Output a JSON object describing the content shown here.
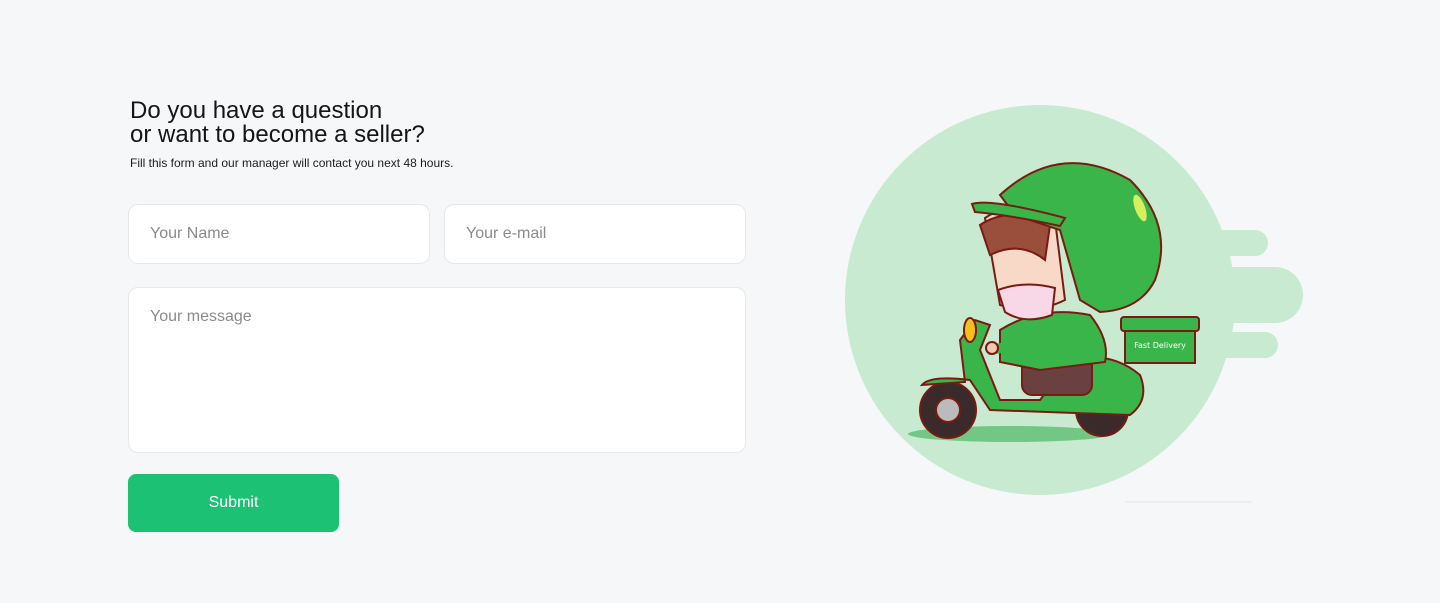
{
  "header": {
    "title_line1": "Do you have a question",
    "title_line2": "or want to become a seller?",
    "subtitle": "Fill this form and our manager will contact you next 48 hours."
  },
  "form": {
    "name_placeholder": "Your Name",
    "email_placeholder": "Your e-mail",
    "message_placeholder": "Your message",
    "submit_label": "Submit"
  },
  "illustration": {
    "box_text": "Fast Delivery"
  },
  "colors": {
    "accent": "#1dc174",
    "circle": "#c7ead0",
    "helmet": "#3ab54a"
  }
}
